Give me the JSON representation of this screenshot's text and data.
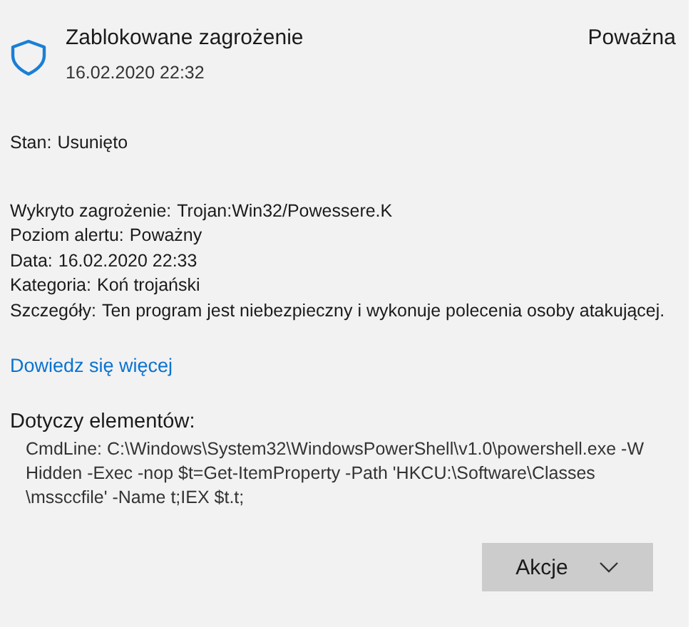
{
  "header": {
    "title": "Zablokowane zagrożenie",
    "date": "16.02.2020 22:32",
    "severity": "Poważna"
  },
  "status": {
    "label": "Stan:",
    "value": "Usunięto"
  },
  "details": [
    {
      "label": "Wykryto zagrożenie:",
      "value": "Trojan:Win32/Powessere.K"
    },
    {
      "label": "Poziom alertu:",
      "value": "Poważny"
    },
    {
      "label": "Data:",
      "value": "16.02.2020 22:33"
    },
    {
      "label": "Kategoria:",
      "value": "Koń trojański"
    },
    {
      "label": "Szczegóły:",
      "value": "Ten program jest niebezpieczny i wykonuje polecenia osoby atakującej."
    }
  ],
  "link": "Dowiedz się więcej",
  "affected": {
    "heading": "Dotyczy elementów:",
    "lines": [
      "CmdLine: C:\\Windows\\System32\\WindowsPowerShell\\v1.0\\powershell.exe -W",
      "Hidden -Exec -nop $t=Get-ItemProperty -Path 'HKCU:\\Software\\Classes",
      "\\mssccfile' -Name t;IEX $t.t;"
    ]
  },
  "actions_button": "Akcje"
}
